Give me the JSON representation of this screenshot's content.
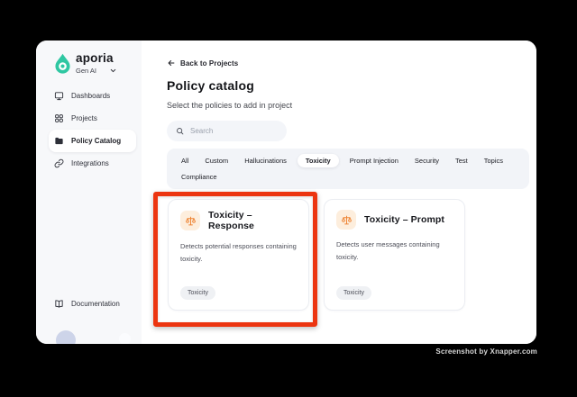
{
  "sidebar": {
    "brand": {
      "name": "aporia",
      "workspace": "Gen AI"
    },
    "items": [
      {
        "label": "Dashboards",
        "icon": "dashboard-icon",
        "active": false
      },
      {
        "label": "Projects",
        "icon": "projects-grid-icon",
        "active": false
      },
      {
        "label": "Policy Catalog",
        "icon": "folder-icon",
        "active": true
      },
      {
        "label": "Integrations",
        "icon": "link-icon",
        "active": false
      }
    ],
    "footer_item": {
      "label": "Documentation",
      "icon": "book-icon"
    }
  },
  "main": {
    "back_link": "Back to Projects",
    "title": "Policy catalog",
    "subtitle": "Select the policies to add in project",
    "search": {
      "placeholder": "Search",
      "icon": "search-icon"
    },
    "tabs": [
      "All",
      "Custom",
      "Hallucinations",
      "Toxicity",
      "Prompt Injection",
      "Security",
      "Test",
      "Topics",
      "Compliance"
    ],
    "active_tab": "Toxicity",
    "cards": [
      {
        "icon": "scales-icon",
        "title": "Toxicity – Response",
        "description": "Detects potential responses containing toxicity.",
        "tag": "Toxicity"
      },
      {
        "icon": "scales-icon",
        "title": "Toxicity – Prompt",
        "description": "Detects user messages containing toxicity.",
        "tag": "Toxicity"
      }
    ]
  },
  "annotation": {
    "type": "highlight-rectangle",
    "color": "#ec3510",
    "target": "Toxicity – Response card"
  },
  "watermark": "Screenshot by Xnapper.com",
  "colors": {
    "brand_teal": "#2fc7a2",
    "highlight_red": "#ec3510",
    "card_icon_orange": "#ee8434",
    "card_icon_bg": "#fdeedd",
    "sidebar_bg": "#f7f8fa",
    "tab_strip_bg": "#f2f4f8"
  }
}
